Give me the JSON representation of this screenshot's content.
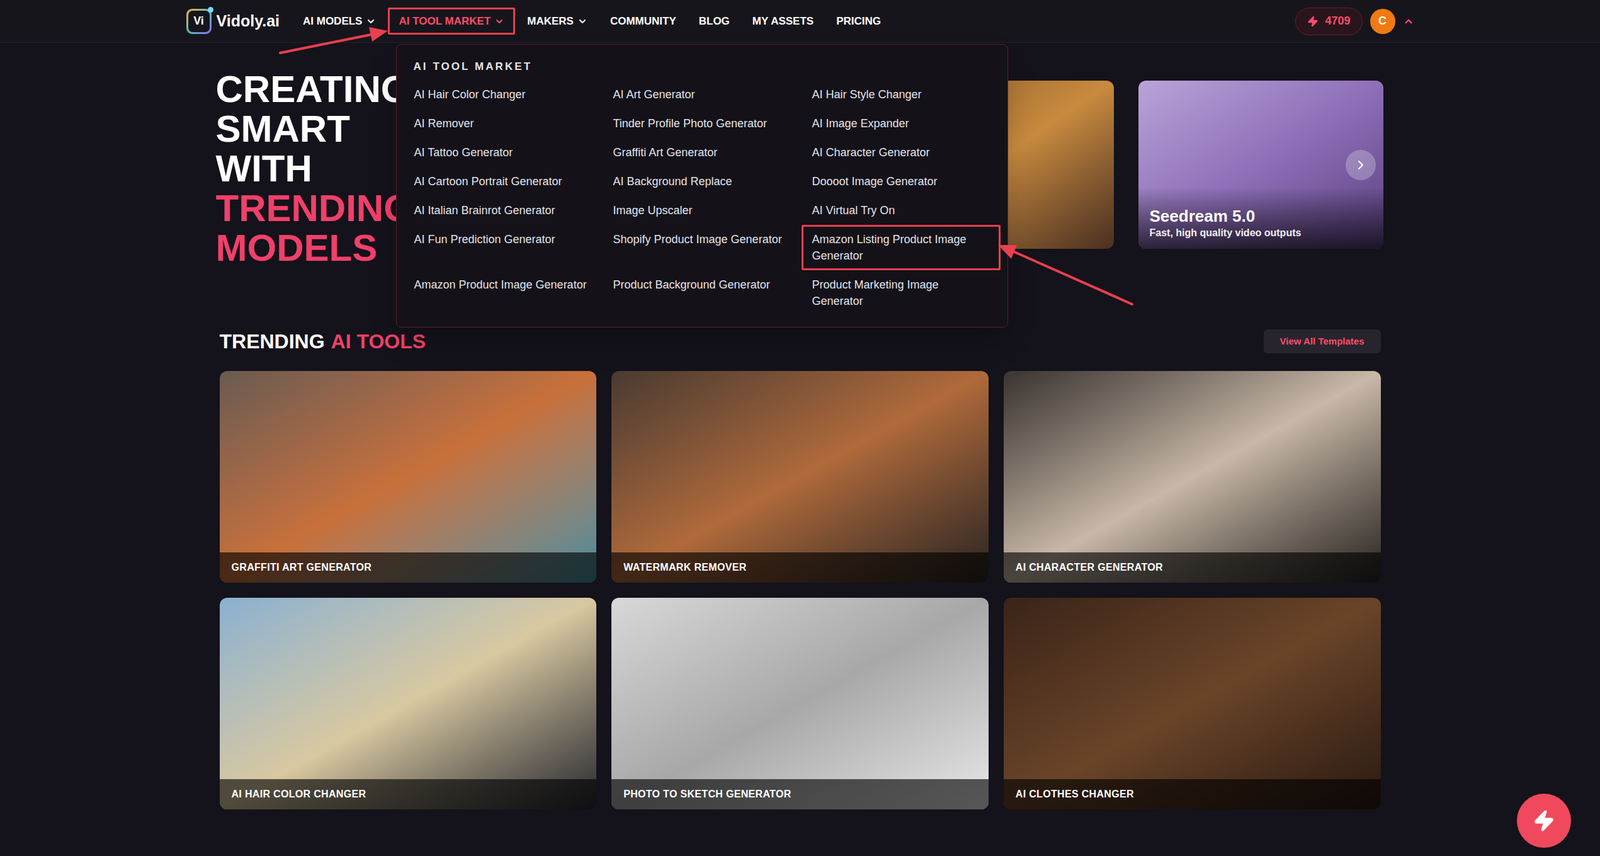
{
  "logo": {
    "mark": "Vi",
    "name": "Vidoly.ai"
  },
  "nav": [
    {
      "label": "AI MODELS",
      "selected": false,
      "has_dropdown": true,
      "highlighted": false
    },
    {
      "label": "AI TOOL MARKET",
      "selected": true,
      "has_dropdown": true,
      "highlighted": true
    },
    {
      "label": "MAKERS",
      "selected": false,
      "has_dropdown": true,
      "highlighted": false
    },
    {
      "label": "COMMUNITY",
      "selected": false,
      "has_dropdown": false,
      "highlighted": false
    },
    {
      "label": "BLOG",
      "selected": false,
      "has_dropdown": false,
      "highlighted": false
    },
    {
      "label": "MY ASSETS",
      "selected": false,
      "has_dropdown": false,
      "highlighted": false
    },
    {
      "label": "PRICING",
      "selected": false,
      "has_dropdown": false,
      "highlighted": false
    }
  ],
  "account": {
    "credits": "4709",
    "avatar": "C",
    "menu_expanded": true
  },
  "dropdown": {
    "open": true,
    "title": "AI TOOL MARKET",
    "items": [
      {
        "label": "AI Hair Color Changer",
        "highlighted": false
      },
      {
        "label": "AI Art Generator",
        "highlighted": false
      },
      {
        "label": "AI Hair Style Changer",
        "highlighted": false
      },
      {
        "label": "AI Remover",
        "highlighted": false
      },
      {
        "label": "Tinder Profile Photo Generator",
        "highlighted": false
      },
      {
        "label": "AI Image Expander",
        "highlighted": false
      },
      {
        "label": "AI Tattoo Generator",
        "highlighted": false
      },
      {
        "label": "Graffiti Art Generator",
        "highlighted": false
      },
      {
        "label": "AI Character Generator",
        "highlighted": false
      },
      {
        "label": "AI Cartoon Portrait Generator",
        "highlighted": false
      },
      {
        "label": "AI Background Replace",
        "highlighted": false
      },
      {
        "label": "Doooot Image Generator",
        "highlighted": false
      },
      {
        "label": "AI Italian Brainrot Generator",
        "highlighted": false
      },
      {
        "label": "Image Upscaler",
        "highlighted": false
      },
      {
        "label": "AI Virtual Try On",
        "highlighted": false
      },
      {
        "label": "AI Fun Prediction Generator",
        "highlighted": false
      },
      {
        "label": "Shopify Product Image Generator",
        "highlighted": false
      },
      {
        "label": "Amazon Listing Product Image Generator",
        "highlighted": true
      },
      {
        "label": "Amazon Product Image Generator",
        "highlighted": false
      },
      {
        "label": "Product Background Generator",
        "highlighted": false
      },
      {
        "label": "Product Marketing Image Generator",
        "highlighted": false
      }
    ]
  },
  "hero": {
    "lines": [
      {
        "text": "CREATING",
        "accent": false
      },
      {
        "text": "SMART",
        "accent": false
      },
      {
        "text": "WITH",
        "accent": false
      },
      {
        "text": "TRENDING",
        "accent": true
      },
      {
        "text": "MODELS",
        "accent": true
      }
    ]
  },
  "carousel": {
    "cards": [
      {
        "title": null,
        "subtitle": null
      },
      {
        "title": null,
        "subtitle": null
      },
      {
        "title": "Seedream 5.0",
        "subtitle": "Fast, high quality video outputs"
      }
    ]
  },
  "trending": {
    "title": "TRENDING",
    "title_accent": "AI TOOLS",
    "button": "View All Templates",
    "cards": [
      {
        "label": "GRAFFITI ART GENERATOR"
      },
      {
        "label": "WATERMARK REMOVER"
      },
      {
        "label": "AI CHARACTER GENERATOR"
      },
      {
        "label": "AI HAIR COLOR CHANGER"
      },
      {
        "label": "PHOTO TO SKETCH GENERATOR"
      },
      {
        "label": "AI CLOTHES CHANGER"
      }
    ]
  }
}
